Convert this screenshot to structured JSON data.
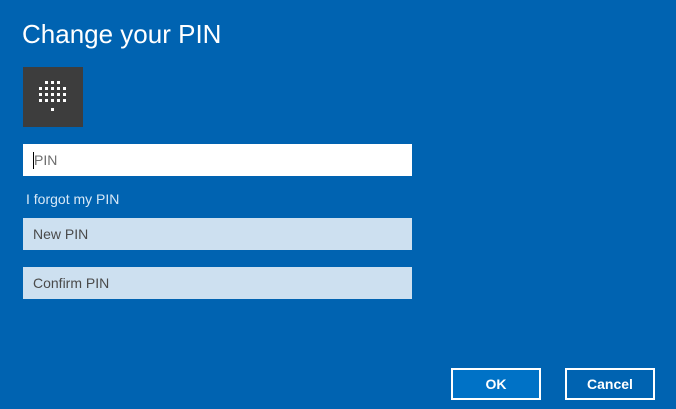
{
  "dialog": {
    "title": "Change your PIN",
    "icon": "pin-keypad-icon",
    "pin_field": {
      "placeholder": "PIN",
      "value": ""
    },
    "forgot_link": "I forgot my PIN",
    "new_pin_field": {
      "placeholder": "New PIN",
      "value": ""
    },
    "confirm_pin_field": {
      "placeholder": "Confirm PIN",
      "value": ""
    },
    "ok_label": "OK",
    "cancel_label": "Cancel"
  },
  "colors": {
    "background": "#0063b1",
    "tile": "#3d3d3d",
    "disabled_field": "#cde0f0",
    "ok_button": "#0072c6"
  }
}
